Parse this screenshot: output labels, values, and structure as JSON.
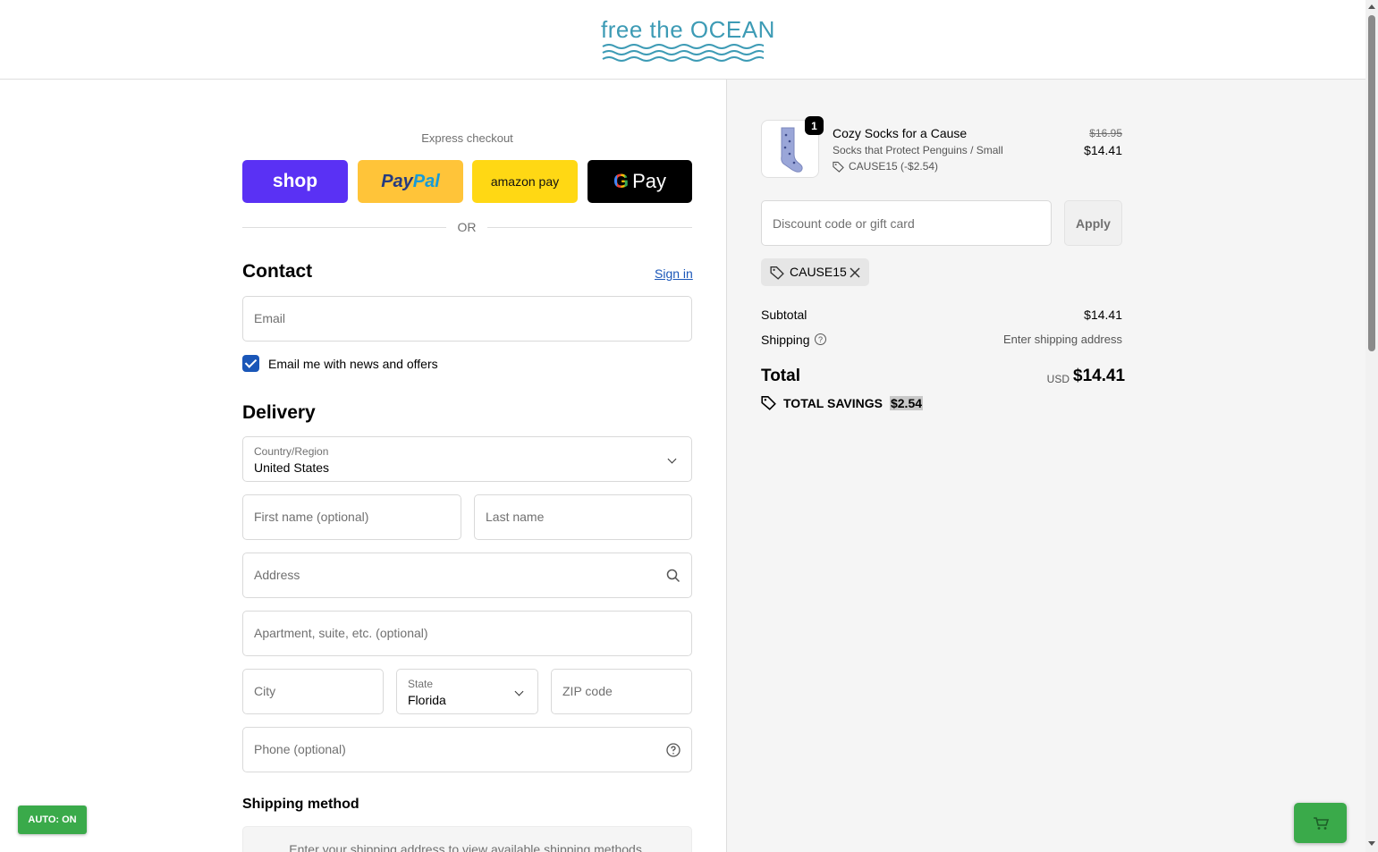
{
  "brand": {
    "logo_text": "free the OCEAN"
  },
  "express": {
    "title": "Express checkout",
    "shop_label": "shop",
    "paypal_label_a": "Pay",
    "paypal_label_b": "Pal",
    "amazon_label": "amazon pay",
    "gpay_g": "G",
    "gpay_label": "Pay",
    "or_label": "OR"
  },
  "contact": {
    "title": "Contact",
    "signin_label": "Sign in",
    "email_placeholder": "Email",
    "newsletter_label": "Email me with news and offers",
    "newsletter_checked": true
  },
  "delivery": {
    "title": "Delivery",
    "country_label": "Country/Region",
    "country_value": "United States",
    "first_name_placeholder": "First name (optional)",
    "last_name_placeholder": "Last name",
    "address_placeholder": "Address",
    "apartment_placeholder": "Apartment, suite, etc. (optional)",
    "city_placeholder": "City",
    "state_label": "State",
    "state_value": "Florida",
    "zip_placeholder": "ZIP code",
    "phone_placeholder": "Phone (optional)"
  },
  "shipping_method": {
    "title": "Shipping method",
    "placeholder_text": "Enter your shipping address to view available shipping methods."
  },
  "auto_toggle": {
    "label": "AUTO: ON"
  },
  "order": {
    "item": {
      "quantity": "1",
      "name": "Cozy Socks for a Cause",
      "variant": "Socks that Protect Penguins / Small",
      "discount": "CAUSE15 (-$2.54)",
      "original_price": "$16.95",
      "price": "$14.41"
    },
    "discount_placeholder": "Discount code or gift card",
    "apply_label": "Apply",
    "applied_code": "CAUSE15",
    "subtotal_label": "Subtotal",
    "subtotal_value": "$14.41",
    "shipping_label": "Shipping",
    "shipping_value": "Enter shipping address",
    "total_label": "Total",
    "currency": "USD",
    "total_value": "$14.41",
    "savings_label": "TOTAL SAVINGS",
    "savings_value": "$2.54"
  },
  "colors": {
    "accent": "#1a56b8",
    "shop": "#5a31f4",
    "paypal": "#ffc439",
    "amazon": "#ffd814",
    "auto_green": "#3aaa4a",
    "logo": "#3d9bb5"
  }
}
